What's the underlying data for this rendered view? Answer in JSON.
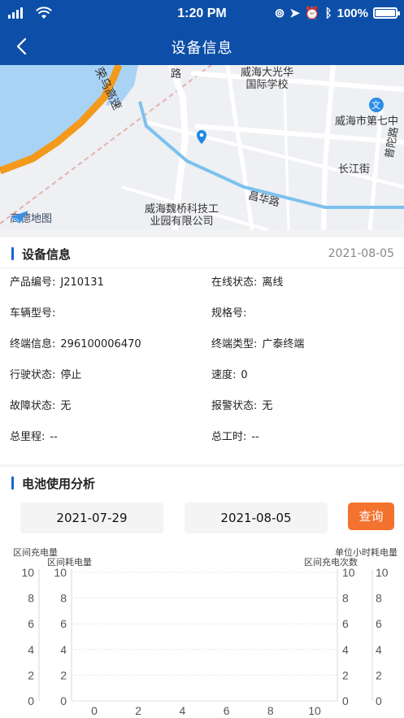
{
  "status": {
    "time": "1:20 PM",
    "battery": "100%"
  },
  "nav": {
    "title": "设备信息"
  },
  "map": {
    "labels": {
      "expressway": "荣乌高速",
      "school": "威海大光华\n国际学校",
      "middle_school": "威海市第七中",
      "changjiang": "长江街",
      "changhua": "昌华路",
      "company": "威海魏桥科技工\n业园有限公司",
      "road_top": "路",
      "puxi": "普陀路"
    },
    "provider": "高德地图",
    "school_badge": "文"
  },
  "device": {
    "title": "设备信息",
    "date": "2021-08-05",
    "fields": [
      {
        "label": "产品编号:",
        "value": "J210131"
      },
      {
        "label": "在线状态:",
        "value": "离线"
      },
      {
        "label": "车辆型号:",
        "value": ""
      },
      {
        "label": "规格号:",
        "value": ""
      },
      {
        "label": "终端信息:",
        "value": "296100006470"
      },
      {
        "label": "终端类型:",
        "value": "广泰终端"
      },
      {
        "label": "行驶状态:",
        "value": "停止"
      },
      {
        "label": "速度:",
        "value": "0"
      },
      {
        "label": "故障状态:",
        "value": "无"
      },
      {
        "label": "报警状态:",
        "value": "无"
      },
      {
        "label": "总里程:",
        "value": "--"
      },
      {
        "label": "总工时:",
        "value": "--"
      }
    ]
  },
  "battery": {
    "title": "电池使用分析",
    "start_date": "2021-07-29",
    "end_date": "2021-08-05",
    "query_label": "查询"
  },
  "chart_data": {
    "type": "bar",
    "title": "",
    "x": [
      0,
      2,
      4,
      6,
      8,
      10
    ],
    "xlim": [
      0,
      10
    ],
    "series": [
      {
        "name": "区间充电量",
        "values": []
      },
      {
        "name": "区间耗电量",
        "values": []
      },
      {
        "name": "区间充电次数",
        "values": []
      },
      {
        "name": "单位小时耗电量",
        "values": []
      }
    ],
    "axes": [
      {
        "label": "区间充电量",
        "side": "left-outer",
        "ylim": [
          0,
          10
        ],
        "ticks": [
          0,
          2,
          4,
          6,
          8,
          10
        ]
      },
      {
        "label": "区间耗电量",
        "side": "left-inner",
        "ylim": [
          0,
          10
        ],
        "ticks": [
          0,
          2,
          4,
          6,
          8,
          10
        ]
      },
      {
        "label": "区间充电次数",
        "side": "right-inner",
        "ylim": [
          0,
          10
        ],
        "ticks": [
          0,
          2,
          4,
          6,
          8,
          10
        ]
      },
      {
        "label": "单位小时耗电量",
        "side": "right-outer",
        "ylim": [
          0,
          10
        ],
        "ticks": [
          0,
          2,
          4,
          6,
          8,
          10
        ]
      }
    ],
    "grid": true
  }
}
